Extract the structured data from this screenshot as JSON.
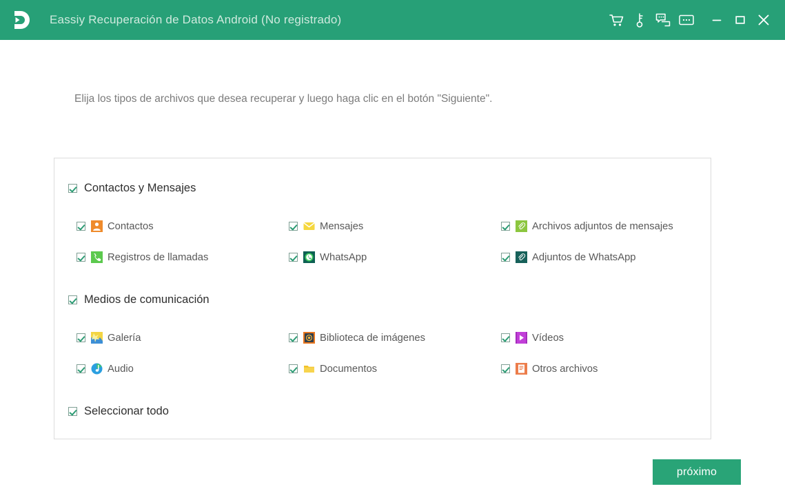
{
  "titlebar": {
    "app_title": "Eassiy Recuperación de Datos Android (No registrado)",
    "logo_name": "eassiy-logo",
    "bg_color": "#27a077",
    "title_color": "#cfeade",
    "icons": [
      {
        "name": "cart-icon",
        "label": "Comprar"
      },
      {
        "name": "key-icon",
        "label": "Registrar"
      },
      {
        "name": "feedback-icon",
        "label": "Comentarios"
      },
      {
        "name": "more-icon",
        "label": "Más"
      }
    ],
    "window_controls": [
      {
        "name": "minimize-button",
        "label": "Minimizar"
      },
      {
        "name": "maximize-button",
        "label": "Maximizar"
      },
      {
        "name": "close-button",
        "label": "Cerrar"
      }
    ]
  },
  "main": {
    "instruction": "Elija los tipos de archivos que desea recuperar y luego haga clic en el botón \"Siguiente\".",
    "groups": [
      {
        "name": "contacts-and-messages",
        "label": "Contactos y Mensajes",
        "checked": true,
        "items": [
          {
            "name": "contacts",
            "label": "Contactos",
            "icon": "contact-icon",
            "checked": true,
            "col": 1,
            "row": 1
          },
          {
            "name": "messages",
            "label": "Mensajes",
            "icon": "envelope-icon",
            "checked": true,
            "col": 2,
            "row": 1
          },
          {
            "name": "message-attachments",
            "label": "Archivos adjuntos de mensajes",
            "icon": "paperclip-green-icon",
            "checked": true,
            "col": 3,
            "row": 1
          },
          {
            "name": "call-logs",
            "label": "Registros de llamadas",
            "icon": "phone-icon",
            "checked": true,
            "col": 1,
            "row": 2
          },
          {
            "name": "whatsapp",
            "label": "WhatsApp",
            "icon": "whatsapp-icon",
            "checked": true,
            "col": 2,
            "row": 2
          },
          {
            "name": "whatsapp-attachments",
            "label": "Adjuntos de WhatsApp",
            "icon": "paperclip-teal-icon",
            "checked": true,
            "col": 3,
            "row": 2
          }
        ]
      },
      {
        "name": "media",
        "label": "Medios de comunicación",
        "checked": true,
        "items": [
          {
            "name": "gallery",
            "label": "Galería",
            "icon": "gallery-icon",
            "checked": true,
            "col": 1,
            "row": 1
          },
          {
            "name": "picture-library",
            "label": "Biblioteca de imágenes",
            "icon": "photo-lib-icon",
            "checked": true,
            "col": 2,
            "row": 1
          },
          {
            "name": "videos",
            "label": "Vídeos",
            "icon": "video-icon",
            "checked": true,
            "col": 3,
            "row": 1
          },
          {
            "name": "audio",
            "label": "Audio",
            "icon": "audio-icon",
            "checked": true,
            "col": 1,
            "row": 2
          },
          {
            "name": "documents",
            "label": "Documentos",
            "icon": "folder-icon",
            "checked": true,
            "col": 2,
            "row": 2
          },
          {
            "name": "other-files",
            "label": "Otros archivos",
            "icon": "document-icon",
            "checked": true,
            "col": 3,
            "row": 2
          }
        ]
      }
    ],
    "select_all": {
      "label": "Seleccionar todo",
      "checked": true
    },
    "next_button": {
      "label": "próximo",
      "color": "#29a477"
    }
  }
}
